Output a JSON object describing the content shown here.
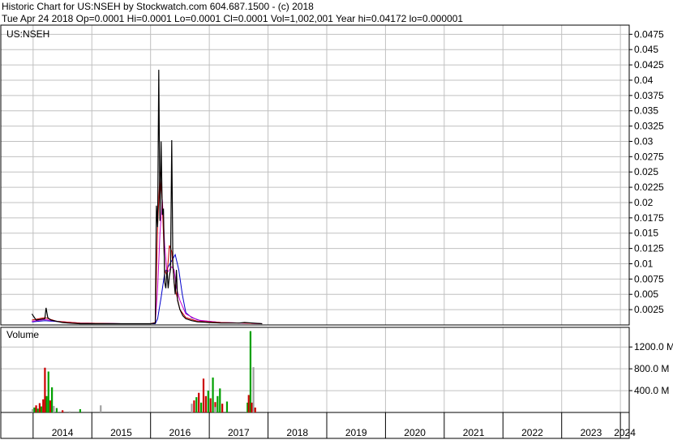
{
  "header": {
    "line1": "Historic Chart for US:NSEH by Stockwatch.com 604.687.1500 - (c) 2018",
    "line2": "Tue Apr 24 2018   Op=0.0001   Hi=0.0001   Lo=0.0001   Cl=0.0001   Vol=1,002,001   Year hi=0.04172   lo=0.000001"
  },
  "colors": {
    "frame": "#000000",
    "grid": "#c0c0c0",
    "price": "#000000",
    "ma_short": "#cc0000",
    "ma_mid": "#cc00cc",
    "ma_long": "#0000cc",
    "vol_up": "#00a000",
    "vol_down": "#cc0000",
    "vol_flat": "#a0a0a0"
  },
  "chart_data": [
    {
      "type": "line",
      "title": "US:NSEH",
      "x_unit": "year",
      "ylim": [
        0,
        0.049
      ],
      "y_ticks": [
        0.0025,
        0.005,
        0.0075,
        0.01,
        0.0125,
        0.015,
        0.0175,
        0.02,
        0.0225,
        0.025,
        0.0275,
        0.03,
        0.0325,
        0.035,
        0.0375,
        0.04,
        0.0425,
        0.045,
        0.0475
      ],
      "y_tick_labels": [
        "0.0025",
        "0.005",
        "0.0075",
        "0.01",
        "0.0125",
        "0.015",
        "0.0175",
        "0.02",
        "0.0225",
        "0.025",
        "0.0275",
        "0.03",
        "0.0325",
        "0.035",
        "0.0375",
        "0.04",
        "0.0425",
        "0.045",
        "0.0475"
      ],
      "grid": true,
      "series": [
        {
          "key": "price",
          "x": [
            2013.98,
            2014.05,
            2014.12,
            2014.2,
            2014.22,
            2014.25,
            2014.3,
            2014.4,
            2014.5,
            2014.6,
            2014.8,
            2015.0,
            2015.3,
            2015.6,
            2015.9,
            2016.0,
            2016.08,
            2016.1,
            2016.12,
            2016.14,
            2016.16,
            2016.18,
            2016.2,
            2016.22,
            2016.24,
            2016.26,
            2016.28,
            2016.3,
            2016.32,
            2016.34,
            2016.36,
            2016.38,
            2016.4,
            2016.42,
            2016.44,
            2016.46,
            2016.5,
            2016.55,
            2016.6,
            2016.7,
            2016.8,
            2017.0,
            2017.2,
            2017.4,
            2017.5,
            2017.6,
            2017.75,
            2017.9
          ],
          "values": [
            0.0018,
            0.0008,
            0.0009,
            0.001,
            0.0028,
            0.0012,
            0.0008,
            0.0006,
            0.0004,
            0.0003,
            0.0002,
            0.0002,
            0.0002,
            0.0002,
            0.0002,
            0.0002,
            0.0003,
            0.0195,
            0.016,
            0.0417,
            0.017,
            0.03,
            0.018,
            0.019,
            0.007,
            0.006,
            0.009,
            0.006,
            0.008,
            0.009,
            0.0302,
            0.01,
            0.007,
            0.005,
            0.009,
            0.004,
            0.0025,
            0.0015,
            0.001,
            0.0007,
            0.0005,
            0.0004,
            0.0003,
            0.0003,
            0.0003,
            0.0004,
            0.0003,
            0.0002
          ]
        },
        {
          "key": "ma_short",
          "x": [
            2013.98,
            2014.2,
            2014.4,
            2014.8,
            2015.5,
            2016.0,
            2016.08,
            2016.12,
            2016.16,
            2016.2,
            2016.24,
            2016.28,
            2016.32,
            2016.36,
            2016.4,
            2016.44,
            2016.5,
            2016.6,
            2016.8,
            2017.2,
            2017.6,
            2017.9
          ],
          "values": [
            0.0008,
            0.0012,
            0.0006,
            0.0003,
            0.0002,
            0.0002,
            0.0004,
            0.016,
            0.025,
            0.02,
            0.009,
            0.008,
            0.013,
            0.012,
            0.007,
            0.005,
            0.0025,
            0.0012,
            0.0006,
            0.0004,
            0.0003,
            0.0002
          ]
        },
        {
          "key": "ma_mid",
          "x": [
            2013.98,
            2014.2,
            2014.4,
            2014.8,
            2015.5,
            2016.0,
            2016.08,
            2016.12,
            2016.16,
            2016.2,
            2016.24,
            2016.28,
            2016.32,
            2016.36,
            2016.4,
            2016.44,
            2016.5,
            2016.6,
            2016.8,
            2017.2,
            2017.6,
            2017.9
          ],
          "values": [
            0.0006,
            0.0009,
            0.0006,
            0.0003,
            0.0002,
            0.0002,
            0.0003,
            0.006,
            0.015,
            0.0205,
            0.013,
            0.0085,
            0.009,
            0.0095,
            0.009,
            0.006,
            0.004,
            0.0018,
            0.0008,
            0.0004,
            0.0003,
            0.0002
          ]
        },
        {
          "key": "ma_long",
          "x": [
            2013.98,
            2014.2,
            2014.5,
            2014.8,
            2015.5,
            2016.0,
            2016.08,
            2016.12,
            2016.18,
            2016.24,
            2016.3,
            2016.36,
            2016.42,
            2016.48,
            2016.54,
            2016.6,
            2016.7,
            2016.85,
            2017.2,
            2017.6,
            2017.9
          ],
          "values": [
            0.0005,
            0.0007,
            0.0005,
            0.0003,
            0.0002,
            0.0002,
            0.0002,
            0.001,
            0.0045,
            0.0085,
            0.0095,
            0.0105,
            0.0115,
            0.009,
            0.005,
            0.002,
            0.0012,
            0.0007,
            0.0004,
            0.0003,
            0.0002
          ]
        }
      ]
    },
    {
      "type": "bar",
      "title": "Volume",
      "x_unit": "year",
      "ylim": [
        0,
        1500
      ],
      "y_ticks": [
        400,
        800,
        1200
      ],
      "y_tick_labels": [
        "400.0 M",
        "800.0 M",
        "1200.0 M"
      ],
      "x_ticks": [
        2014,
        2015,
        2016,
        2017,
        2018,
        2019,
        2020,
        2021,
        2022,
        2023,
        2024
      ],
      "x_tick_labels": [
        "2014",
        "2015",
        "2016",
        "2017",
        "2018",
        "2019",
        "2020",
        "2021",
        "2022",
        "2023",
        "2024"
      ],
      "xlim": [
        2013.45,
        2024.15
      ],
      "bars": [
        {
          "x": 2013.99,
          "v": 60,
          "c": "vol_flat"
        },
        {
          "x": 2014.02,
          "v": 90,
          "c": "vol_up"
        },
        {
          "x": 2014.05,
          "v": 130,
          "c": "vol_down"
        },
        {
          "x": 2014.08,
          "v": 70,
          "c": "vol_up"
        },
        {
          "x": 2014.11,
          "v": 170,
          "c": "vol_down"
        },
        {
          "x": 2014.14,
          "v": 110,
          "c": "vol_up"
        },
        {
          "x": 2014.17,
          "v": 240,
          "c": "vol_down"
        },
        {
          "x": 2014.2,
          "v": 820,
          "c": "vol_down"
        },
        {
          "x": 2014.23,
          "v": 300,
          "c": "vol_up"
        },
        {
          "x": 2014.26,
          "v": 750,
          "c": "vol_up"
        },
        {
          "x": 2014.29,
          "v": 220,
          "c": "vol_down"
        },
        {
          "x": 2014.32,
          "v": 460,
          "c": "vol_up"
        },
        {
          "x": 2014.35,
          "v": 120,
          "c": "vol_flat"
        },
        {
          "x": 2014.4,
          "v": 80,
          "c": "vol_up"
        },
        {
          "x": 2014.5,
          "v": 40,
          "c": "vol_down"
        },
        {
          "x": 2014.62,
          "v": 20,
          "c": "vol_flat"
        },
        {
          "x": 2014.8,
          "v": 60,
          "c": "vol_up"
        },
        {
          "x": 2015.15,
          "v": 130,
          "c": "vol_flat"
        },
        {
          "x": 2016.7,
          "v": 160,
          "c": "vol_flat"
        },
        {
          "x": 2016.74,
          "v": 220,
          "c": "vol_down"
        },
        {
          "x": 2016.78,
          "v": 280,
          "c": "vol_up"
        },
        {
          "x": 2016.82,
          "v": 360,
          "c": "vol_down"
        },
        {
          "x": 2016.86,
          "v": 180,
          "c": "vol_up"
        },
        {
          "x": 2016.9,
          "v": 620,
          "c": "vol_down"
        },
        {
          "x": 2016.94,
          "v": 300,
          "c": "vol_down"
        },
        {
          "x": 2016.98,
          "v": 400,
          "c": "vol_up"
        },
        {
          "x": 2017.02,
          "v": 260,
          "c": "vol_down"
        },
        {
          "x": 2017.06,
          "v": 640,
          "c": "vol_up"
        },
        {
          "x": 2017.1,
          "v": 190,
          "c": "vol_down"
        },
        {
          "x": 2017.14,
          "v": 300,
          "c": "vol_up"
        },
        {
          "x": 2017.18,
          "v": 440,
          "c": "vol_up"
        },
        {
          "x": 2017.22,
          "v": 160,
          "c": "vol_down"
        },
        {
          "x": 2017.3,
          "v": 200,
          "c": "vol_up"
        },
        {
          "x": 2017.1,
          "v": 100,
          "c": "vol_flat"
        },
        {
          "x": 2017.65,
          "v": 180,
          "c": "vol_up"
        },
        {
          "x": 2017.67,
          "v": 320,
          "c": "vol_down"
        },
        {
          "x": 2017.7,
          "v": 1490,
          "c": "vol_up"
        },
        {
          "x": 2017.72,
          "v": 180,
          "c": "vol_down"
        },
        {
          "x": 2017.75,
          "v": 830,
          "c": "vol_flat"
        },
        {
          "x": 2017.78,
          "v": 90,
          "c": "vol_down"
        }
      ]
    }
  ]
}
